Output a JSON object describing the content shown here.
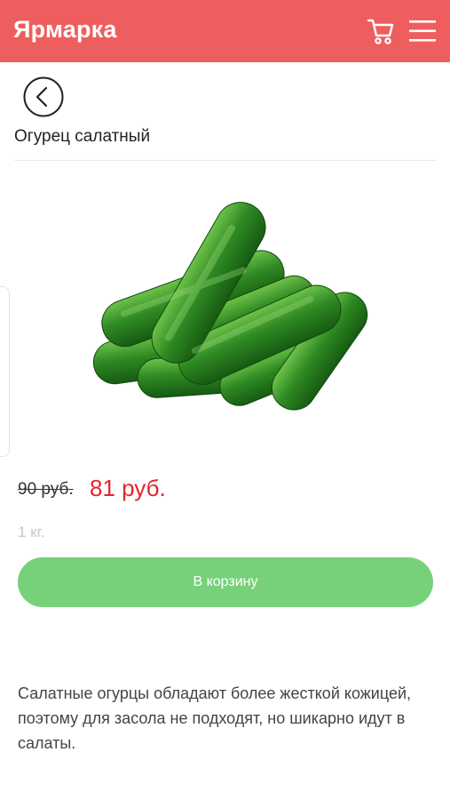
{
  "header": {
    "brand": "Ярмарка",
    "cart_icon": "cart-icon",
    "menu_icon": "hamburger-menu-icon",
    "bg_color": "#ef5e5e"
  },
  "nav": {
    "back_icon": "chevron-left-icon"
  },
  "product": {
    "name": "Огурец салатный",
    "image": "cucumbers-photo",
    "old_price": "90 руб.",
    "price": "81 руб.",
    "weight": "1 кг.",
    "add_to_cart_label": "В корзину",
    "description": "Салатные огурцы обладают более жесткой кожицей, поэтому для засола не подходят, но шикарно идут в салаты.",
    "price_color": "#e5242c",
    "button_color": "#77d17a"
  }
}
